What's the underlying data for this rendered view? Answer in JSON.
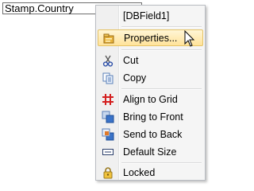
{
  "field": {
    "text": "Stamp.Country"
  },
  "menu": {
    "header": "[DBField1]",
    "properties": {
      "label": "Properties...",
      "icon": "properties-icon"
    },
    "cut": {
      "label": "Cut",
      "icon": "scissors-icon"
    },
    "copy": {
      "label": "Copy",
      "icon": "copy-icon"
    },
    "align_to_grid": {
      "label": "Align to Grid",
      "icon": "grid-icon"
    },
    "bring_to_front": {
      "label": "Bring to Front",
      "icon": "bring-to-front-icon"
    },
    "send_to_back": {
      "label": "Send to Back",
      "icon": "send-to-back-icon"
    },
    "default_size": {
      "label": "Default Size",
      "icon": "default-size-icon"
    },
    "locked": {
      "label": "Locked",
      "icon": "lock-icon"
    }
  },
  "colors": {
    "highlight": "#ffe39a",
    "grid_icon": "#d42020"
  }
}
